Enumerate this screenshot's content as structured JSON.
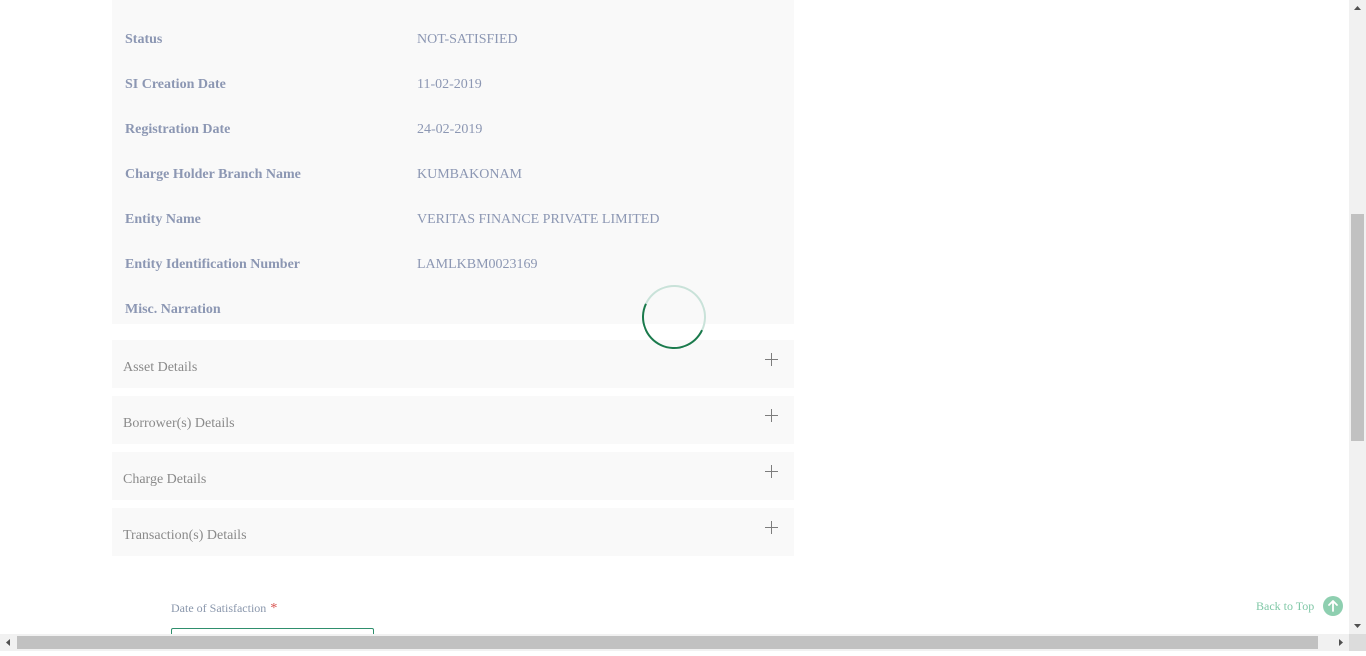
{
  "details_table": {
    "rows": [
      {
        "label": "Status",
        "value": "NOT-SATISFIED"
      },
      {
        "label": "SI Creation Date",
        "value": "11-02-2019"
      },
      {
        "label": "Registration Date",
        "value": "24-02-2019"
      },
      {
        "label": "Charge Holder Branch Name",
        "value": "KUMBAKONAM"
      },
      {
        "label": "Entity Name",
        "value": "VERITAS FINANCE PRIVATE LIMITED"
      },
      {
        "label": "Entity Identification Number",
        "value": "LAMLKBM0023169"
      },
      {
        "label": "Misc. Narration",
        "value": ""
      }
    ]
  },
  "accordions": [
    {
      "title": "Asset Details",
      "icon": "plus-icon"
    },
    {
      "title": "Borrower(s) Details",
      "icon": "plus-icon"
    },
    {
      "title": "Charge Details",
      "icon": "plus-icon"
    },
    {
      "title": "Transaction(s) Details",
      "icon": "plus-icon"
    }
  ],
  "form": {
    "date_of_satisfaction_label": "Date of Satisfaction",
    "required_marker": "*",
    "date_of_satisfaction_value": ""
  },
  "back_to_top": {
    "label": "Back to Top",
    "icon": "arrow-up-circle-icon"
  },
  "colors": {
    "label": "#8c97b3",
    "accent_green": "#1a7a4c",
    "back_to_top": "#7fc7a6",
    "required": "#d9534f"
  }
}
